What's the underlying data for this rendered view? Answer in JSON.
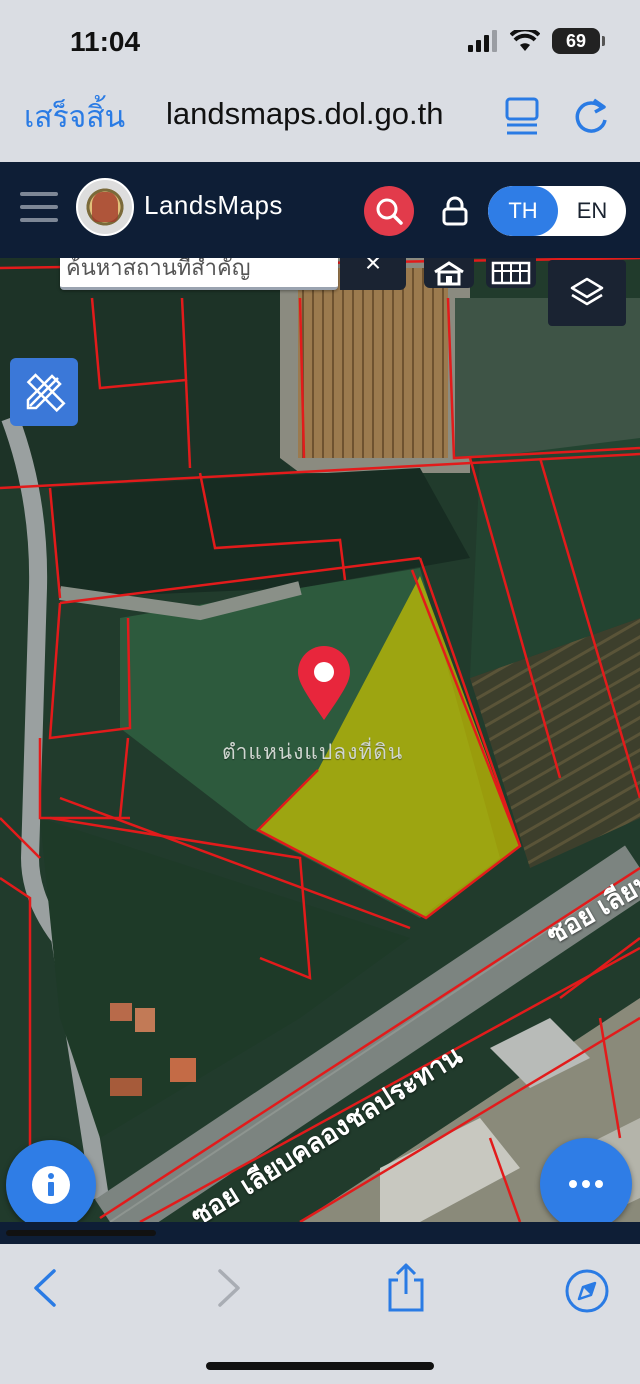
{
  "status_bar": {
    "time": "11:04",
    "battery": "69"
  },
  "browser": {
    "done_label": "เสร็จสิ้น",
    "url": "landsmaps.dol.go.th"
  },
  "header": {
    "brand": "LandsMaps",
    "lang_th": "TH",
    "lang_en": "EN"
  },
  "map": {
    "search_placeholder": "ค้นหาสถานที่สำคัญ",
    "search_clear": "×",
    "parcel_label": "ตำแหน่งแปลงที่ดิน",
    "road_label_1": "ซอย เลียบคลองชลประทาน",
    "road_label_2": "ซอย เลียบ"
  },
  "colors": {
    "accent": "#2f7de6",
    "header_bg": "#0e1e36",
    "parcel_fill": "#c9c200",
    "boundary": "#e21b1b",
    "pin": "#e8263c"
  }
}
